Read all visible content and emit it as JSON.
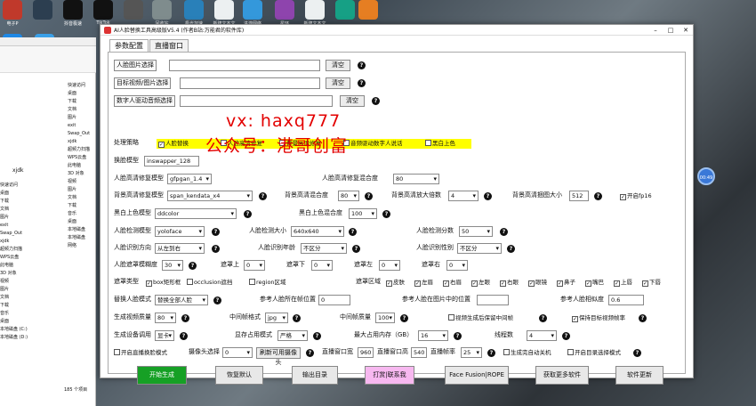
{
  "desktop": {
    "icons": [
      {
        "label": "电子P",
        "color": "#c0392b"
      },
      {
        "label": "",
        "color": "#2c3e50"
      },
      {
        "label": "抖音极速",
        "color": "#111111"
      },
      {
        "label": "TikTok",
        "color": "#111111"
      },
      {
        "label": "",
        "color": "#555555"
      },
      {
        "label": "回收站",
        "color": "#7f8c8d"
      },
      {
        "label": "极光加速",
        "color": "#2980b9"
      },
      {
        "label": "新建文本文档",
        "color": "#ecf0f1"
      },
      {
        "label": "进游网络",
        "color": "#3498db"
      },
      {
        "label": "星环",
        "color": "#8e44ad"
      },
      {
        "label": "新建文本文档",
        "color": "#ecf0f1"
      },
      {
        "label": "",
        "color": "#16a085"
      },
      {
        "label": "",
        "color": "#e67e22"
      }
    ],
    "left_icons": [
      {
        "label": "EV录屏",
        "color": "#1e88e5"
      },
      {
        "label": "",
        "color": "#3aa0e8"
      }
    ],
    "float_ball": "00:49"
  },
  "explorer": {
    "nav": [
      "快速访问",
      "桌面",
      "下载",
      "文档",
      "图片",
      "exit",
      "Swap_Out",
      "xjdk",
      "超频力扫描",
      "WPS云盘",
      "此电脑",
      "3D 对象",
      "视频",
      "图片",
      "文档",
      "下载",
      "音乐",
      "桌面",
      "本地磁盘",
      "本地磁盘",
      "网络"
    ],
    "left": [
      "快速访问",
      "桌面",
      "下载",
      "文档",
      "图片",
      "exit",
      "Swap_Out",
      "xjdk",
      "超频力扫描",
      "WPS云盘",
      "此电脑",
      "3D 对象",
      "视频",
      "图片",
      "文档",
      "下载",
      "音乐",
      "桌面",
      "本地磁盘 (C:)",
      "本地磁盘 (D:)"
    ],
    "path": "xjdk",
    "status": "185 个项目"
  },
  "app": {
    "title": "AI人脸替换工具高级版V5.4 (作者B站:万能君的软件库)",
    "tabs": [
      "参数配置",
      "直播窗口"
    ],
    "face_image_label": "人脸图片选择",
    "face_image_value": "",
    "target_label": "目标视频/图片选择",
    "target_value": "",
    "digital_audio_label": "数字人驱动音频选择",
    "digital_audio_value": "",
    "clear_label": "清空",
    "strategy_label": "处理策略",
    "strategy_options": [
      {
        "label": "人脸替换",
        "checked": true
      },
      {
        "label": "人脸高清修复",
        "checked": false
      },
      {
        "label": "背景高清修复",
        "checked": false
      },
      {
        "label": "音频驱动数字人说话",
        "checked": false
      },
      {
        "label": "黑白上色",
        "checked": false
      }
    ],
    "swap_model_label": "换脸模型",
    "swap_model_value": "inswapper_128",
    "face_enhance_model_label": "人脸高清修复模型",
    "face_enhance_model_value": "gfpgan_1.4",
    "face_enhance_blend_label": "人脸高清修复混合度",
    "face_enhance_blend_value": "80",
    "bg_model_label": "背景高清修复模型",
    "bg_model_value": "span_kendata_x4",
    "bg_blend_label": "背景高清混合度",
    "bg_blend_value": "80",
    "bg_scale_label": "背景高清放大倍数",
    "bg_scale_value": "4",
    "bg_tile_label": "背景高清捆图大小",
    "bg_tile_value": "512",
    "fp16_label": "开启fp16",
    "fp16_checked": true,
    "colorize_model_label": "黑白上色模型",
    "colorize_model_value": "ddcolor",
    "colorize_blend_label": "黑白上色混合度",
    "colorize_blend_value": "100",
    "detect_model_label": "人脸检测模型",
    "detect_model_value": "yoloface",
    "detect_size_label": "人脸检测大小",
    "detect_size_value": "640x640",
    "detect_score_label": "人脸检测分数",
    "detect_score_value": "50",
    "orient_label": "人脸识别方向",
    "orient_value": "从左到右",
    "age_label": "人脸识别年龄",
    "age_value": "不区分",
    "gender_label": "人脸识别性别",
    "gender_value": "不区分",
    "mask_blur_label": "人脸遮罩模糊度",
    "mask_blur_value": "30",
    "occ_top_label": "遮罩上",
    "occ_top_value": "0",
    "occ_bottom_label": "遮罩下",
    "occ_bottom_value": "0",
    "occ_left_label": "遮罩左",
    "occ_left_value": "0",
    "occ_right_label": "遮罩右",
    "occ_right_value": "0",
    "mask_type_label": "遮罩类型",
    "mask_types": [
      {
        "label": "box矩形框",
        "checked": true
      },
      {
        "label": "occlusion遮挡",
        "checked": false
      },
      {
        "label": "region区域",
        "checked": false
      }
    ],
    "mask_region_label": "遮罩区域",
    "mask_regions": [
      {
        "label": "皮肤",
        "checked": true
      },
      {
        "label": "左眉",
        "checked": true
      },
      {
        "label": "右眉",
        "checked": true
      },
      {
        "label": "左眼",
        "checked": true
      },
      {
        "label": "右眼",
        "checked": true
      },
      {
        "label": "眼镜",
        "checked": true
      },
      {
        "label": "鼻子",
        "checked": true
      },
      {
        "label": "嘴巴",
        "checked": true
      },
      {
        "label": "上唇",
        "checked": true
      },
      {
        "label": "下唇",
        "checked": true
      }
    ],
    "swap_mode_label": "替换人脸模式",
    "swap_mode_value": "替换全部人脸",
    "ref_pos_label": "参考人脸所在帧位置",
    "ref_pos_value": "0",
    "ref_img_pos_label": "参考人脸在图片中的位置",
    "ref_img_pos_value": "",
    "ref_sim_label": "参考人脸相似度",
    "ref_sim_value": "0.6",
    "quality_label": "生成视频质量",
    "quality_value": "80",
    "frame_fmt_label": "中间帧格式",
    "frame_fmt_value": "jpg",
    "frame_quality_label": "中间帧质量",
    "frame_quality_value": "100",
    "keep_frames_label": "视频生成后保留中间帧",
    "keep_frames_checked": false,
    "keep_fps_label": "保持目标视频帧率",
    "keep_fps_checked": true,
    "device_label": "生成设备调用",
    "device_value": "显卡",
    "vram_label": "显存占用模式",
    "vram_value": "严格",
    "max_mem_label": "最大占用内存（GB）",
    "max_mem_value": "16",
    "threads_label": "线程数",
    "threads_value": "4",
    "live_mode_label": "开启直播换脸模式",
    "live_mode_checked": false,
    "camera_label": "摄像头选择",
    "camera_value": "0",
    "refresh_camera_label": "刷新可用摄像头",
    "live_w_label": "直播窗口宽",
    "live_w_value": "960",
    "live_h_label": "直播窗口高",
    "live_h_value": "540",
    "live_fps_label": "直播帧率",
    "live_fps_value": "25",
    "auto_shutdown_label": "生成完自动关机",
    "auto_shutdown_checked": false,
    "dir_mode_label": "开启目录选择模式",
    "dir_mode_checked": false,
    "btn_start": "开始生成",
    "btn_reset": "恢复默认",
    "btn_output": "输出目录",
    "btn_contact": "打赏|联系我",
    "btn_facefusion": "Face Fusion|ROPE",
    "btn_more": "获取更多软件",
    "btn_update": "软件更新",
    "start_color": "#16a025",
    "contact_color": "#f7b8f0",
    "highlight_color": "#ffff00"
  },
  "watermark": {
    "line1": "vx: haxq777",
    "line2": "公众号：港哥创富"
  }
}
